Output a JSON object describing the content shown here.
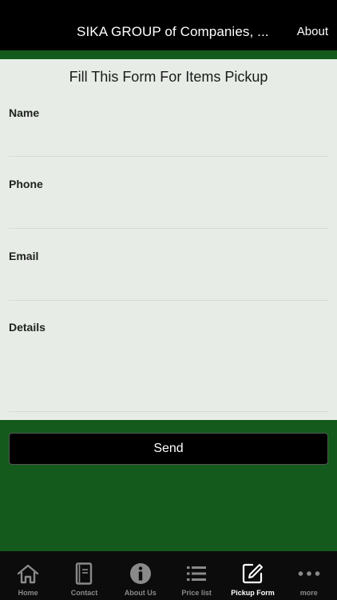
{
  "header": {
    "title": "SIKA GROUP of Companies, ...",
    "about_label": "About"
  },
  "form": {
    "title": "Fill This Form For Items Pickup",
    "fields": [
      {
        "label": "Name",
        "value": ""
      },
      {
        "label": "Phone",
        "value": ""
      },
      {
        "label": "Email",
        "value": ""
      },
      {
        "label": "Details",
        "value": ""
      }
    ],
    "send_label": "Send"
  },
  "tabbar": {
    "tabs": [
      {
        "label": "Home",
        "icon": "home-icon"
      },
      {
        "label": "Contact",
        "icon": "contact-icon"
      },
      {
        "label": "About Us",
        "icon": "info-icon"
      },
      {
        "label": "Price list",
        "icon": "list-icon"
      },
      {
        "label": "Pickup Form",
        "icon": "edit-icon",
        "active": true
      },
      {
        "label": "more",
        "icon": "more-icon"
      }
    ]
  },
  "colors": {
    "header_bg": "#000000",
    "accent_green": "#135a1c",
    "form_bg": "#e7ede6",
    "tabbar_bg": "#0c0c0c"
  }
}
